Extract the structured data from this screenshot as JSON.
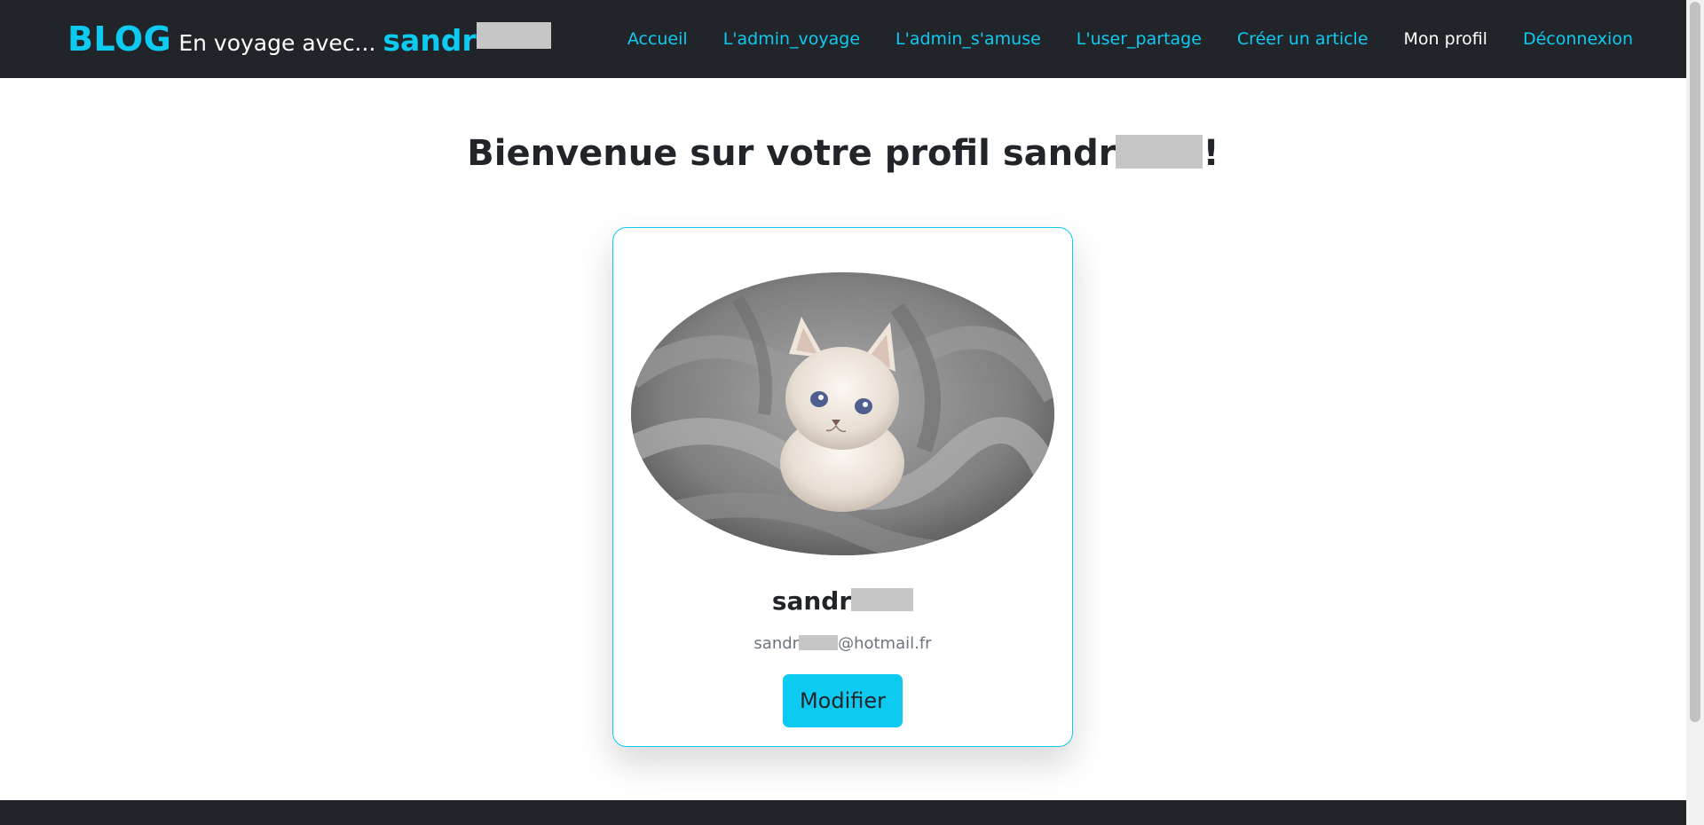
{
  "brand": {
    "blog": "BLOG",
    "tagline": "En voyage avec...",
    "user": "sandr"
  },
  "nav": {
    "items": [
      {
        "label": "Accueil",
        "active": false
      },
      {
        "label": "L'admin_voyage",
        "active": false
      },
      {
        "label": "L'admin_s'amuse",
        "active": false
      },
      {
        "label": "L'user_partage",
        "active": false
      },
      {
        "label": "Créer un article",
        "active": false
      },
      {
        "label": "Mon profil",
        "active": true
      },
      {
        "label": "Déconnexion",
        "active": false
      }
    ]
  },
  "page": {
    "title_prefix": "Bienvenue sur votre profil sandr",
    "title_suffix": "!"
  },
  "profile": {
    "name": "sandr",
    "email_prefix": "sandr",
    "email_suffix": "@hotmail.fr",
    "avatar_subject": "kitten-in-gray-blanket",
    "modify_label": "Modifier"
  },
  "colors": {
    "accent": "#0dcaf0",
    "navbar": "#212529",
    "text": "#212529",
    "muted": "#6c757d",
    "redacted": "#c6c6c6"
  }
}
